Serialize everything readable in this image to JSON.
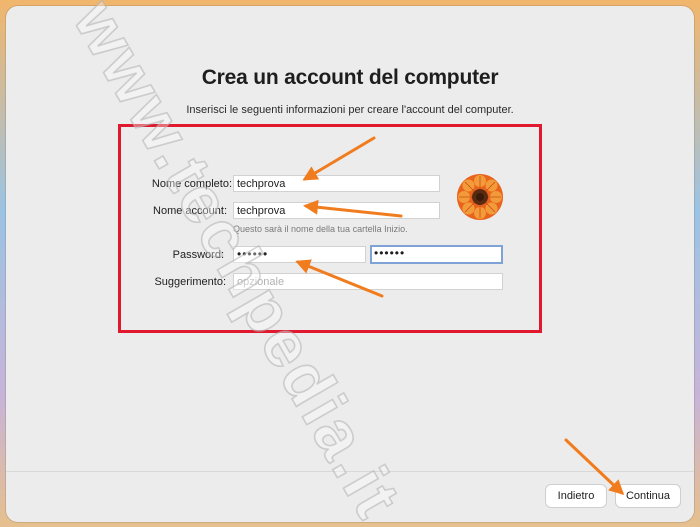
{
  "dialog": {
    "title": "Crea un account del computer",
    "subtitle": "Inserisci le seguenti informazioni per creare l'account del computer."
  },
  "form": {
    "full_name": {
      "label": "Nome completo:",
      "value": "techprova"
    },
    "account_name": {
      "label": "Nome account:",
      "value": "techprova",
      "hint": "Questo sarà il nome della tua cartella Inizio."
    },
    "password": {
      "label": "Password:",
      "value": "••••••",
      "verify_value": "••••••"
    },
    "hint_field": {
      "label": "Suggerimento:",
      "placeholder": "opzionale"
    }
  },
  "avatar": {
    "icon": "orange-flower-avatar-icon"
  },
  "buttons": {
    "back_label": "Indietro",
    "continue_label": "Continua"
  },
  "watermark": {
    "text": "www.techpedia.it"
  },
  "colors": {
    "highlight_box": "#e0192e",
    "arrow": "#f07c1e",
    "focus_ring": "#7fa3d6"
  }
}
